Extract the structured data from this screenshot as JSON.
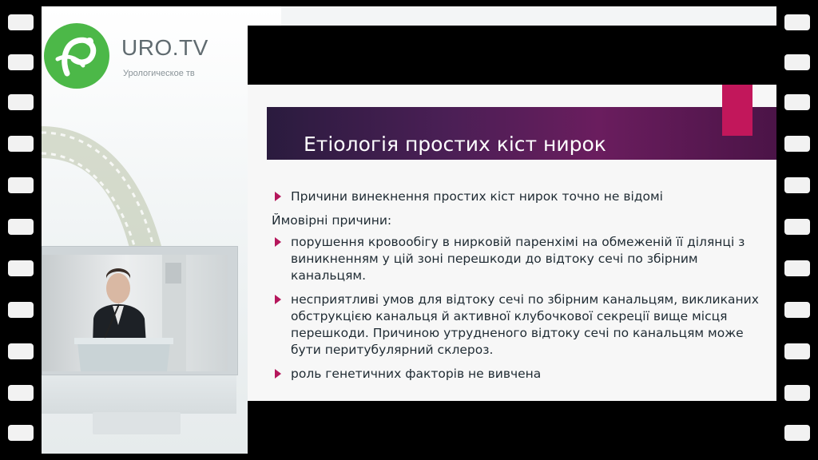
{
  "brand": {
    "title": "URO.TV",
    "subtitle": "Урологическое тв"
  },
  "slide": {
    "title": "Етіологія простих кіст нирок",
    "bullet_1": "Причини винекнення простих кіст нирок точно не відомі",
    "probable_label": "Ймовірні причини:",
    "bullet_2": "порушення кровообігу в нирковій паренхімі на обмеженій її ділянці з виникненням у цій зоні перешкоди до відтоку сечі по збірним канальцям.",
    "bullet_3": "несприятливі умов для відтоку сечі по збірним канальцям, викликаних обструкцією канальця й активної клубочкової секреції вище місця перешкоди. Причиною утрудненого відтоку сечі по канальцям може бути перитубулярний склероз.",
    "bullet_4": "роль генетичних факторів не вивчена"
  },
  "colors": {
    "logo_green": "#4cb848",
    "accent_magenta": "#c2175b",
    "banner_purple": "#4a1f55"
  }
}
